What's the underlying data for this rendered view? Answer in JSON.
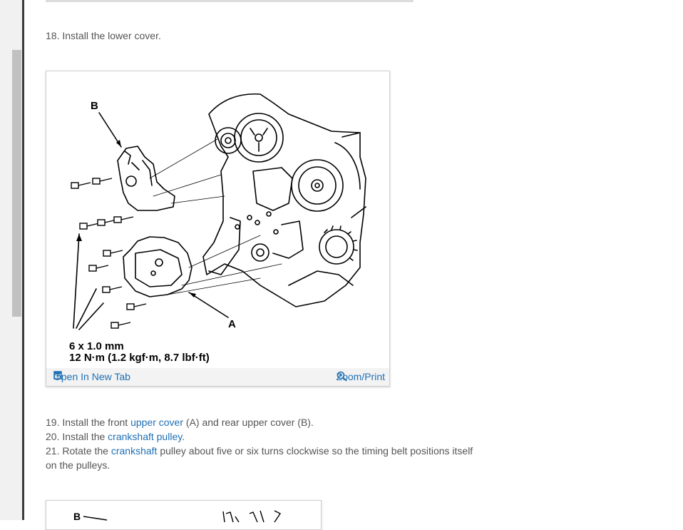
{
  "steps": {
    "s18": "18. Install the lower cover.",
    "s19_pre": "19. Install the front ",
    "s19_link": "upper cover",
    "s19_post": " (A) and rear upper cover (B).",
    "s20_pre": "20. Install the ",
    "s20_link": "crankshaft pulley",
    "s20_post": ".",
    "s21_pre": "21. Rotate the ",
    "s21_link": "crankshaft",
    "s21_post": " pulley about five or six turns clockwise so the timing belt positions itself",
    "s21_cont": "on the pulleys."
  },
  "figure1": {
    "label_a": "A",
    "label_b": "B",
    "caption_line1": "6 x 1.0 mm",
    "caption_line2": "12 N·m (1.2 kgf·m, 8.7 lbf·ft)",
    "open_tab_label": "Open In New Tab",
    "zoom_label": "Zoom/Print"
  },
  "figure2": {
    "label_b": "B"
  },
  "colors": {
    "link": "#1f6fb3",
    "text": "#555555",
    "divider": "#3c3c3c"
  }
}
